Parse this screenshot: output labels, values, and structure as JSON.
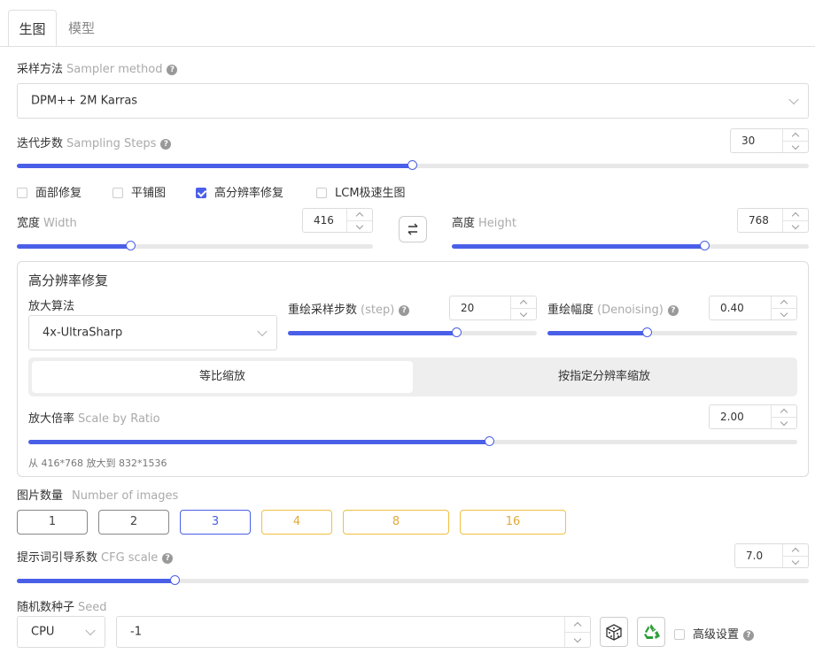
{
  "tabs": [
    {
      "label": "生图",
      "active": true
    },
    {
      "label": "模型",
      "active": false
    }
  ],
  "sampler": {
    "label": "采样方法",
    "label_en": "Sampler method",
    "value": "DPM++ 2M Karras"
  },
  "steps": {
    "label": "迭代步数",
    "label_en": "Sampling Steps",
    "value": "30",
    "fraction": 0.5
  },
  "checkboxes": [
    {
      "label": "面部修复",
      "checked": false
    },
    {
      "label": "平铺图",
      "checked": false
    },
    {
      "label": "高分辨率修复",
      "checked": true
    },
    {
      "label": "LCM极速生图",
      "checked": false
    }
  ],
  "width": {
    "label": "宽度",
    "label_en": "Width",
    "value": "416",
    "fraction": 0.32
  },
  "height": {
    "label": "高度",
    "label_en": "Height",
    "value": "768",
    "fraction": 0.71
  },
  "hires": {
    "title": "高分辨率修复",
    "upscaler_label": "放大算法",
    "upscaler_value": "4x-UltraSharp",
    "hr_steps": {
      "label": "重绘采样步数",
      "label_en": "(step)",
      "value": "20",
      "fraction": 0.68
    },
    "denoise": {
      "label": "重绘幅度",
      "label_en": "(Denoising)",
      "value": "0.40",
      "fraction": 0.4
    },
    "modes": [
      {
        "label": "等比缩放",
        "active": true
      },
      {
        "label": "按指定分辨率缩放",
        "active": false
      }
    ],
    "scale": {
      "label": "放大倍率",
      "label_en": "Scale by Ratio",
      "value": "2.00",
      "fraction": 0.6
    },
    "hint": "从 416*768 放大到 832*1536"
  },
  "images": {
    "label": "图片数量",
    "label_en": "Number of images",
    "options": [
      {
        "label": "1",
        "state": "normal"
      },
      {
        "label": "2",
        "state": "normal"
      },
      {
        "label": "3",
        "state": "selected"
      },
      {
        "label": "4",
        "state": "warn"
      },
      {
        "label": "8",
        "state": "warn"
      },
      {
        "label": "16",
        "state": "warn"
      }
    ]
  },
  "cfg": {
    "label": "提示词引导系数",
    "label_en": "CFG scale",
    "value": "7.0",
    "fraction": 0.2
  },
  "seed": {
    "label": "随机数种子",
    "label_en": "Seed",
    "device": "CPU",
    "value": "-1",
    "advanced_label": "高级设置",
    "advanced_checked": false
  },
  "icons": {
    "dice": "dice-icon",
    "recycle": "recycle-icon",
    "swap": "swap-icon",
    "help": "help-icon"
  },
  "colors": {
    "accent": "#4a5fe8",
    "warn": "#e2a93a",
    "recycle": "#2e9e3a"
  }
}
